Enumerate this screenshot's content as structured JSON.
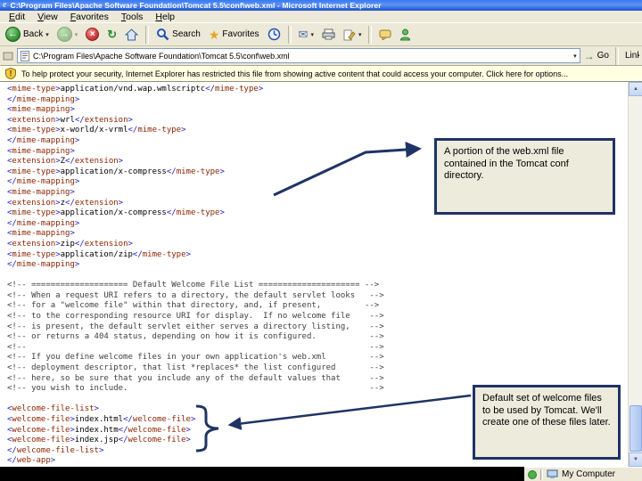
{
  "window": {
    "title": "C:\\Program Files\\Apache Software Foundation\\Tomcat 5.5\\conf\\web.xml - Microsoft Internet Explorer",
    "logo_glyph": "e"
  },
  "menu": {
    "items": [
      "Edit",
      "View",
      "Favorites",
      "Tools",
      "Help"
    ]
  },
  "toolbar": {
    "back_label": "Back",
    "search_label": "Search",
    "favorites_label": "Favorites"
  },
  "address": {
    "value": "C:\\Program Files\\Apache Software Foundation\\Tomcat 5.5\\conf\\web.xml",
    "go_label": "Go",
    "links_label": "Links"
  },
  "infobar": {
    "text": "To help protect your security, Internet Explorer has restricted this file from showing active content that could access your computer. Click here for options..."
  },
  "xml_lines": [
    "<mime-type>application/vnd.wap.wmlscriptc</mime-type>",
    "</mime-mapping>",
    "<mime-mapping>",
    "<extension>wrl</extension>",
    "<mime-type>x-world/x-vrml</mime-type>",
    "</mime-mapping>",
    "<mime-mapping>",
    "<extension>Z</extension>",
    "<mime-type>application/x-compress</mime-type>",
    "</mime-mapping>",
    "<mime-mapping>",
    "<extension>z</extension>",
    "<mime-type>application/x-compress</mime-type>",
    "</mime-mapping>",
    "<mime-mapping>",
    "<extension>zip</extension>",
    "<mime-type>application/zip</mime-type>",
    "</mime-mapping>",
    "",
    "<!-- ==================== Default Welcome File List ===================== -->",
    "<!-- When a request URI refers to a directory, the default servlet looks   -->",
    "<!-- for a \"welcome file\" within that directory, and, if present,         -->",
    "<!-- to the corresponding resource URI for display.  If no welcome file    -->",
    "<!-- is present, the default servlet either serves a directory listing,    -->",
    "<!-- or returns a 404 status, depending on how it is configured.           -->",
    "<!--                                                                       -->",
    "<!-- If you define welcome files in your own application's web.xml         -->",
    "<!-- deployment descriptor, that list *replaces* the list configured       -->",
    "<!-- here, so be sure that you include any of the default values that      -->",
    "<!-- you wish to include.                                                  -->",
    "",
    "<welcome-file-list>",
    "<welcome-file>index.html</welcome-file>",
    "<welcome-file>index.htm</welcome-file>",
    "<welcome-file>index.jsp</welcome-file>",
    "</welcome-file-list>",
    "</web-app>"
  ],
  "annotations": {
    "note1": "A portion of the web.xml file contained in the Tomcat conf directory.",
    "note2": "Default set of welcome files to be used by Tomcat.  We'll create one of these files later."
  },
  "statusbar": {
    "zone": "My Computer"
  },
  "colors": {
    "titlebar_blue": "#2E66E8",
    "chrome": "#ECE9D8",
    "infobar_bg": "#FFFFE1",
    "annotation_border": "#1F3365",
    "annotation_bg": "#EDEBDC",
    "arrow": "#1F3365",
    "xml_bracket": "#2222C8",
    "xml_tag": "#8B2500",
    "xml_comment": "#3F3F3F"
  }
}
